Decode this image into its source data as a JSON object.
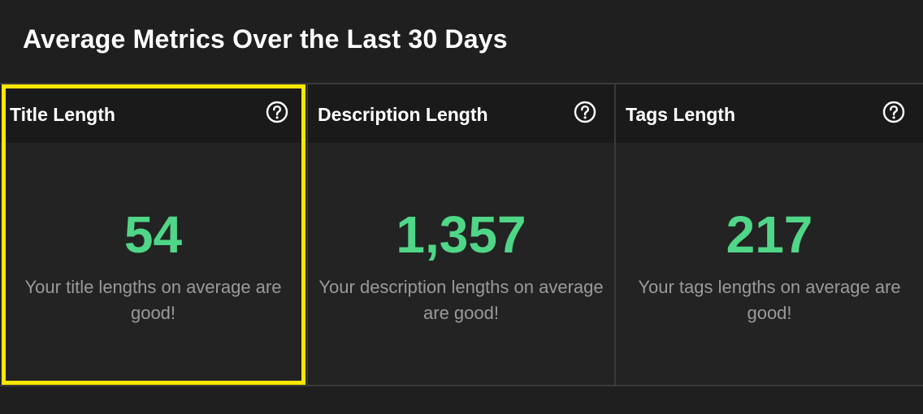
{
  "header": {
    "title": "Average Metrics Over the Last 30 Days"
  },
  "colors": {
    "value": "#4fd687",
    "highlight": "#ffe600"
  },
  "cards": [
    {
      "title": "Title Length",
      "value": "54",
      "description": "Your title lengths on average are good!",
      "icon": "help-circle-icon",
      "selected": true
    },
    {
      "title": "Description Length",
      "value": "1,357",
      "description": "Your description lengths on average are good!",
      "icon": "help-circle-icon",
      "selected": false
    },
    {
      "title": "Tags Length",
      "value": "217",
      "description": "Your tags lengths on average are good!",
      "icon": "help-circle-icon",
      "selected": false
    }
  ]
}
